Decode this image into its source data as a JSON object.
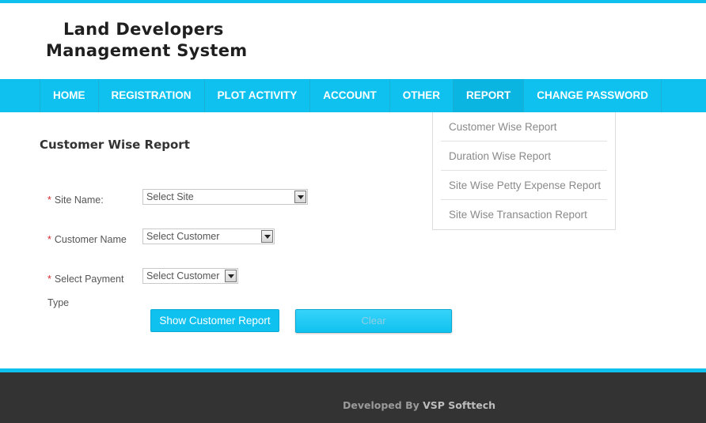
{
  "header": {
    "logo_line1": "Land Developers",
    "logo_line2": "Management System"
  },
  "nav": {
    "items": [
      {
        "label": "HOME"
      },
      {
        "label": "REGISTRATION"
      },
      {
        "label": "PLOT ACTIVITY"
      },
      {
        "label": "ACCOUNT"
      },
      {
        "label": "OTHER"
      },
      {
        "label": "REPORT",
        "active": true
      },
      {
        "label": "CHANGE PASSWORD"
      }
    ]
  },
  "report_menu": {
    "items": [
      {
        "label": "Customer Wise Report"
      },
      {
        "label": "Duration Wise Report"
      },
      {
        "label": "Site Wise Petty Expense Report"
      },
      {
        "label": "Site Wise Transaction Report"
      }
    ]
  },
  "page": {
    "title": "Customer Wise Report"
  },
  "form": {
    "required_marker": "*",
    "site_label": "Site Name:",
    "site_select": "Select Site",
    "customer_label": "Customer Name",
    "customer_select": "Select Customer",
    "payment_label_line1": "Select Payment",
    "payment_label_line2": "Type",
    "payment_select": "Select Customer",
    "show_button": "Show Customer Report",
    "clear_button": "Clear"
  },
  "footer": {
    "prefix": "Developed By ",
    "brand": "VSP Softtech"
  },
  "colors": {
    "accent": "#0ec1ee",
    "footer_bg": "#333333",
    "required": "#d62b2b"
  }
}
